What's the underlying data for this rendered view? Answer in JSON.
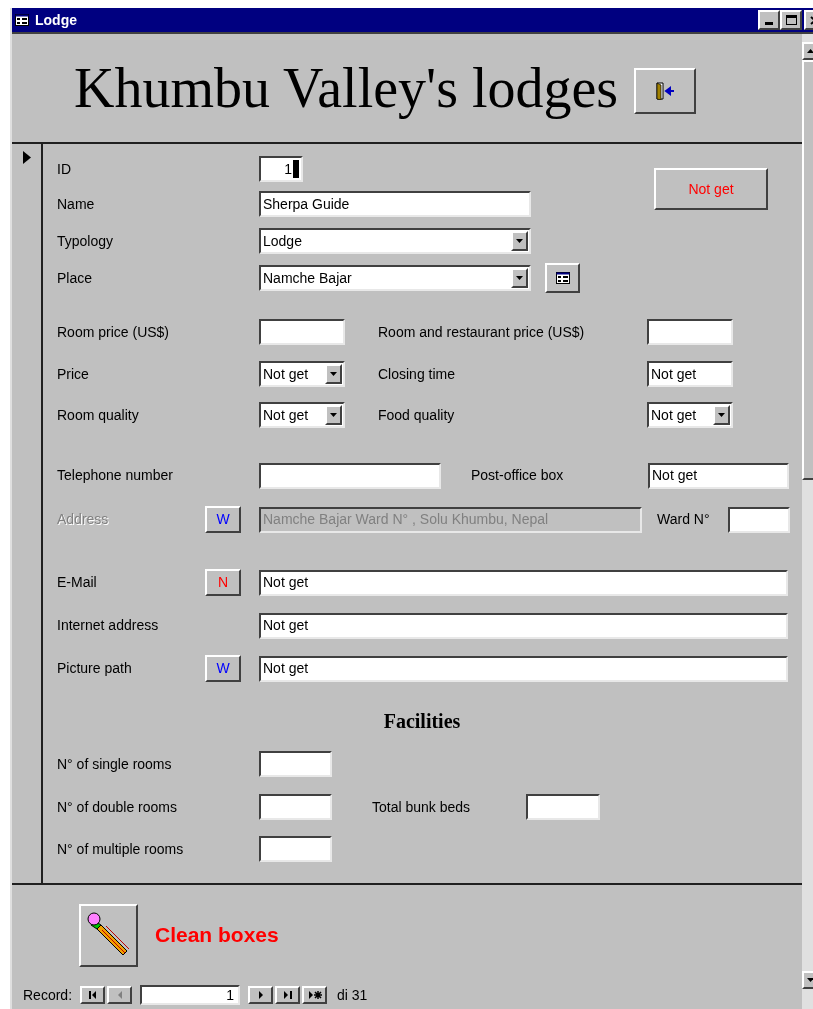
{
  "window": {
    "title": "Lodge"
  },
  "header": {
    "title": "Khumbu Valley's lodges"
  },
  "record_selector": {
    "current": true
  },
  "identity": [
    {
      "label": "ID",
      "kind": "number",
      "value": "1",
      "focused": true
    },
    {
      "label": "Name",
      "kind": "text",
      "value": "Sherpa Guide",
      "focused": false
    },
    {
      "label": "Typology",
      "kind": "combo",
      "value": "Lodge",
      "focused": false
    },
    {
      "label": "Place",
      "kind": "combo",
      "value": "Namche Bajar",
      "focused": false
    }
  ],
  "status_button": {
    "label": "Not get"
  },
  "prices": [
    {
      "left": {
        "label": "Room price (US$)",
        "kind": "text"
      },
      "right": {
        "label": "Room and restaurant price (US$)",
        "kind": "text"
      }
    },
    {
      "left": {
        "label": "Price",
        "kind": "combo",
        "value": "Not get"
      },
      "right": {
        "label": "Closing time",
        "kind": "text",
        "value": "Not get"
      }
    },
    {
      "left": {
        "label": "Room quality",
        "kind": "combo",
        "value": "Not get"
      },
      "right": {
        "label": "Food quality",
        "kind": "combo",
        "value": "Not get"
      }
    }
  ],
  "contact": [
    {
      "label": "Telephone number",
      "disabled": false,
      "extra": {
        "label": "Post-office box",
        "value": "Not get"
      }
    },
    {
      "label": "Address",
      "disabled": true,
      "button": {
        "label": "W",
        "color": "#0000ff"
      },
      "value": "Namche Bajar Ward N° , Solu Khumbu, Nepal",
      "extra": {
        "label": "Ward N°"
      }
    },
    {
      "label": "E-Mail",
      "disabled": false,
      "button": {
        "label": "N",
        "color": "#ff0000"
      },
      "value": "Not get"
    },
    {
      "label": "Internet address",
      "disabled": false,
      "value": "Not get"
    },
    {
      "label": "Picture path",
      "disabled": false,
      "button": {
        "label": "W",
        "color": "#0000ff"
      },
      "value": "Not get"
    }
  ],
  "facilities": {
    "title": "Facilities",
    "rows": [
      {
        "label": "N° of single rooms"
      },
      {
        "label": "N° of double rooms",
        "extra": {
          "label": "Total bunk beds"
        }
      },
      {
        "label": "N° of multiple rooms"
      }
    ]
  },
  "footer": {
    "clean_label": "Clean boxes"
  },
  "record_nav": {
    "label": "Record:",
    "buttons": [
      {
        "kind": "first",
        "disabled": false
      },
      {
        "kind": "prev",
        "disabled": true
      }
    ],
    "current": "1",
    "buttons_after": [
      {
        "kind": "next",
        "disabled": false
      },
      {
        "kind": "last",
        "disabled": false
      },
      {
        "kind": "new",
        "disabled": false
      }
    ],
    "total": "di 31"
  }
}
